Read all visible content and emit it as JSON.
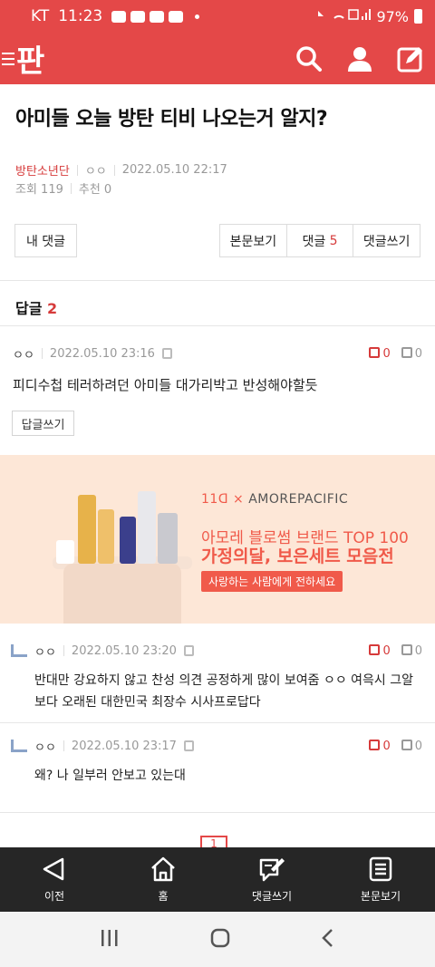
{
  "status_bar": {
    "carrier": "KT",
    "time": "11:23",
    "battery": "97%"
  },
  "header": {
    "logo": "판",
    "icons": [
      "search-icon",
      "user-icon",
      "write-icon"
    ]
  },
  "post": {
    "title": "아미들 오늘 방탄 티비 나오는거 알지?",
    "category": "방탄소년단",
    "author": "ㅇㅇ",
    "datetime": "2022.05.10 22:17",
    "views_label": "조회 119",
    "recommend_label": "추천 0"
  },
  "buttons": {
    "my_comments": "내 댓글",
    "view_post": "본문보기",
    "comments_label": "댓글",
    "comments_count": "5",
    "write_comment": "댓글쓰기"
  },
  "replies": {
    "label": "답글",
    "count": "2"
  },
  "comments": [
    {
      "author": "ㅇㅇ",
      "datetime": "2022.05.10 23:16",
      "up": "0",
      "down": "0",
      "text": "피디수첩 테러하려던 아미들 대가리박고 반성해야할듯",
      "reply_button": "답글쓰기"
    },
    {
      "author": "ㅇㅇ",
      "datetime": "2022.05.10 23:20",
      "up": "0",
      "down": "0",
      "text_line1": "반대만 강요하지 않고 찬성 의견 공정하게 많이 보여줌 ㅇㅇ 여윽시 그알",
      "text_line2": "보다 오래된 대한민국 최장수 시사프로답다"
    },
    {
      "author": "ㅇㅇ",
      "datetime": "2022.05.10 23:17",
      "up": "0",
      "down": "0",
      "text": "왜? 나 일부러 안보고 있는대"
    }
  ],
  "ad": {
    "brand_left": "11ᗡ",
    "brand_right": "AMOREPACIFIC",
    "line1": "아모레 블로썸 브랜드 TOP 100",
    "line2": "가정의달, 보은세트 모음전",
    "cta": "사랑하는 사람에게 전하세요"
  },
  "pagination": {
    "current": "1"
  },
  "bottom_nav": {
    "prev": "이전",
    "home": "홈",
    "write_comment": "댓글쓰기",
    "view_post": "본문보기"
  },
  "colors": {
    "brand": "#e44848",
    "accent": "#d63a3a",
    "ad_bg": "#fde7d7",
    "nav_bg": "#262626"
  }
}
